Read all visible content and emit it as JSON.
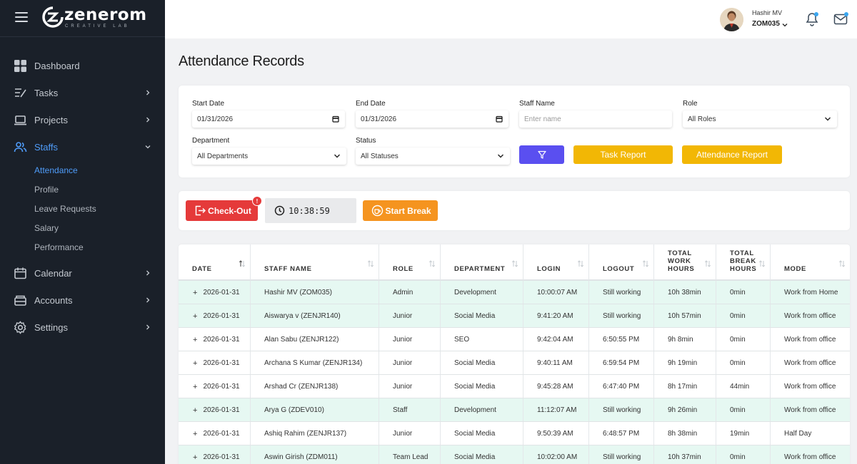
{
  "brand": {
    "name": "zenerom",
    "tagline": "CREATIVE LAB"
  },
  "sidebar": {
    "items": [
      {
        "label": "Dashboard",
        "icon": "dashboard-grid-icon"
      },
      {
        "label": "Tasks",
        "icon": "tasks-icon"
      },
      {
        "label": "Projects",
        "icon": "laptop-icon"
      },
      {
        "label": "Staffs",
        "icon": "users-icon"
      },
      {
        "label": "Calendar",
        "icon": "calendar-icon"
      },
      {
        "label": "Accounts",
        "icon": "accounts-icon"
      },
      {
        "label": "Settings",
        "icon": "gear-icon"
      }
    ],
    "subitems": [
      "Attendance",
      "Profile",
      "Leave Requests",
      "Salary",
      "Performance"
    ],
    "active_subitem": "Attendance"
  },
  "user": {
    "name": "Hashir MV",
    "code": "ZOM035"
  },
  "page": {
    "title": "Attendance Records"
  },
  "filters": {
    "start_date": {
      "label": "Start Date",
      "value": "01/31/2026"
    },
    "end_date": {
      "label": "End Date",
      "value": "01/31/2026"
    },
    "staff_name": {
      "label": "Staff Name",
      "placeholder": "Enter name"
    },
    "role": {
      "label": "Role",
      "value": "All Roles"
    },
    "department": {
      "label": "Department",
      "value": "All Departments"
    },
    "status": {
      "label": "Status",
      "value": "All Statuses"
    },
    "task_report_label": "Task Report",
    "attendance_report_label": "Attendance Report"
  },
  "actions": {
    "checkout_label": "Check-Out",
    "checkout_badge": "!",
    "timer": "10:38:59",
    "break_label": "Start Break"
  },
  "table": {
    "columns": [
      {
        "label": "DATE"
      },
      {
        "label": "STAFF NAME"
      },
      {
        "label": "ROLE"
      },
      {
        "label": "DEPARTMENT"
      },
      {
        "label": "LOGIN"
      },
      {
        "label": "LOGOUT"
      },
      {
        "label": "TOTAL WORK HOURS",
        "lines": [
          "TOTAL",
          "WORK",
          "HOURS"
        ]
      },
      {
        "label": "TOTAL BREAK HOURS",
        "lines": [
          "TOTAL",
          "BREAK",
          "HOURS"
        ]
      },
      {
        "label": "MODE"
      }
    ],
    "rows": [
      {
        "date": "2026-01-31",
        "staff": "Hashir MV (ZOM035)",
        "role": "Admin",
        "department": "Development",
        "login": "10:00:07 AM",
        "logout": "Still working",
        "work": "10h 38min",
        "break": "0min",
        "mode": "Work from Home",
        "highlight": true
      },
      {
        "date": "2026-01-31",
        "staff": "Aiswarya v (ZENJR140)",
        "role": "Junior",
        "department": "Social Media",
        "login": "9:41:20 AM",
        "logout": "Still working",
        "work": "10h 57min",
        "break": "0min",
        "mode": "Work from office",
        "highlight": true
      },
      {
        "date": "2026-01-31",
        "staff": "Alan Sabu (ZENJR122)",
        "role": "Junior",
        "department": "SEO",
        "login": "9:42:04 AM",
        "logout": "6:50:55 PM",
        "work": "9h 8min",
        "break": "0min",
        "mode": "Work from office",
        "highlight": false
      },
      {
        "date": "2026-01-31",
        "staff": "Archana S Kumar (ZENJR134)",
        "role": "Junior",
        "department": "Social Media",
        "login": "9:40:11 AM",
        "logout": "6:59:54 PM",
        "work": "9h 19min",
        "break": "0min",
        "mode": "Work from office",
        "highlight": false
      },
      {
        "date": "2026-01-31",
        "staff": "Arshad Cr (ZENJR138)",
        "role": "Junior",
        "department": "Social Media",
        "login": "9:45:28 AM",
        "logout": "6:47:40 PM",
        "work": "8h 17min",
        "break": "44min",
        "mode": "Work from office",
        "highlight": false
      },
      {
        "date": "2026-01-31",
        "staff": "Arya G (ZDEV010)",
        "role": "Staff",
        "department": "Development",
        "login": "11:12:07 AM",
        "logout": "Still working",
        "work": "9h 26min",
        "break": "0min",
        "mode": "Work from office",
        "highlight": true
      },
      {
        "date": "2026-01-31",
        "staff": "Ashiq Rahim (ZENJR137)",
        "role": "Junior",
        "department": "Social Media",
        "login": "9:50:39 AM",
        "logout": "6:48:57 PM",
        "work": "8h 38min",
        "break": "19min",
        "mode": "Half Day",
        "highlight": false
      },
      {
        "date": "2026-01-31",
        "staff": "Aswin Girish (ZDM011)",
        "role": "Team Lead",
        "department": "Social Media",
        "login": "10:02:00 AM",
        "logout": "Still working",
        "work": "10h 37min",
        "break": "0min",
        "mode": "Work from office",
        "highlight": true
      }
    ]
  },
  "colors": {
    "sidebar_bg": "#1a2029",
    "accent_blue": "#4f9cf9",
    "checkout_red": "#e53a3a",
    "break_orange": "#f5941f",
    "report_yellow": "#f2b705",
    "filter_purple": "#5a4ff0",
    "row_highlight": "#e6f8f2"
  }
}
